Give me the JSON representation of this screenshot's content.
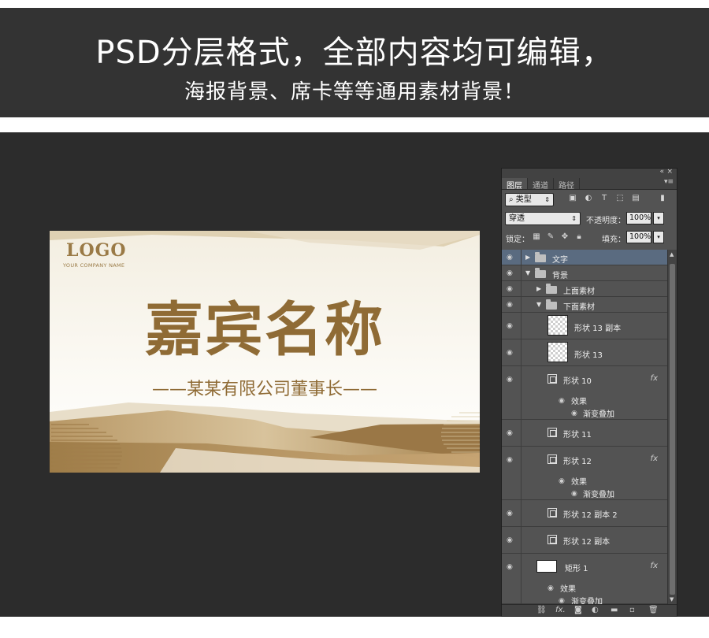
{
  "banner": {
    "headline": "PSD分层格式，全部内容均可编辑，",
    "subline": "海报背景、席卡等等通用素材背景！"
  },
  "card": {
    "logo": "LOGO",
    "company": "YOUR COMPANY NAME",
    "title": "嘉宾名称",
    "subtitle": "——某某有限公司董事长——",
    "colors": {
      "gold": "#8f6b35",
      "light_gold": "#c9b48e",
      "cream": "#f3eee1"
    }
  },
  "panel": {
    "tabs": [
      {
        "label": "图层"
      },
      {
        "label": "通道"
      },
      {
        "label": "路径"
      }
    ],
    "filter_kind": "类型",
    "blend_mode": "穿透",
    "opacity_label": "不透明度：",
    "opacity_value": "100%",
    "lock_label": "锁定：",
    "fill_label": "填充：",
    "fill_value": "100%",
    "layers": [
      {
        "name": "文字"
      },
      {
        "name": "背景"
      },
      {
        "name": "上面素材"
      },
      {
        "name": "下面素材"
      },
      {
        "name": "形状 13 副本"
      },
      {
        "name": "形状 13"
      },
      {
        "name": "形状 10",
        "effects": "效果",
        "effect_item": "渐变叠加"
      },
      {
        "name": "形状 11"
      },
      {
        "name": "形状 12",
        "effects": "效果",
        "effect_item": "渐变叠加"
      },
      {
        "name": "形状 12 副本 2"
      },
      {
        "name": "形状 12 副本"
      },
      {
        "name": "矩形 1",
        "effects": "效果",
        "effect_item": "渐变叠加"
      }
    ],
    "fx_label": "fx",
    "icons": [
      "image-filter-icon",
      "adjust-filter-icon",
      "type-filter-icon",
      "shape-filter-icon",
      "smart-filter-icon",
      "link-icon",
      "fx-icon",
      "mask-icon",
      "adjustment-icon",
      "new-group-icon",
      "new-layer-icon",
      "trash-icon"
    ]
  }
}
